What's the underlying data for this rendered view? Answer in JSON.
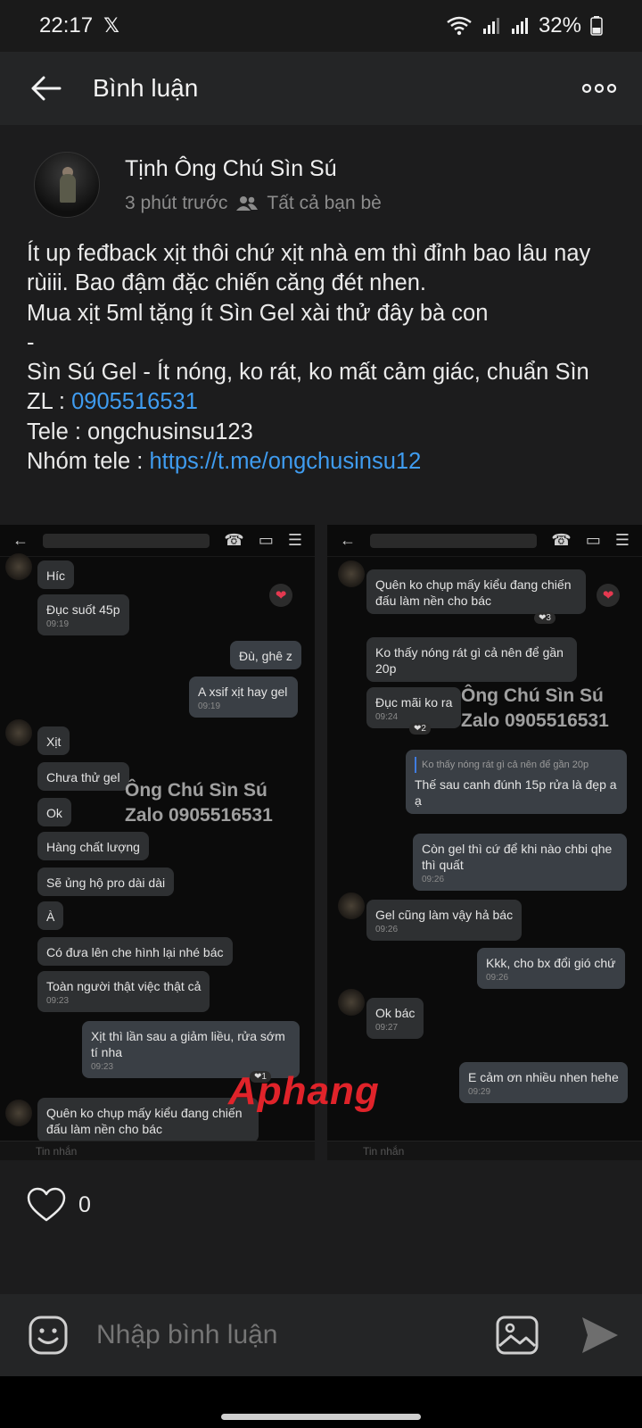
{
  "status_bar": {
    "time": "22:17",
    "battery": "32%"
  },
  "header": {
    "title": "Bình luận"
  },
  "post": {
    "author": "Tịnh Ông Chú Sìn Sú",
    "time": "3 phút trước",
    "audience": "Tất cả bạn bè",
    "lines": {
      "l1": "Ít up feđback xịt thôi chứ xịt nhà em thì đỉnh bao lâu nay rùiii. Bao đậm đặc chiến căng đét nhen.",
      "l2": "Mua xịt 5ml tặng ít Sìn Gel xài thử đây bà con",
      "l3": "-",
      "l4": "Sìn Sú Gel - Ít nóng, ko rát, ko mất cảm giác, chuẩn Sìn",
      "zl_label": "ZL : ",
      "zl_value": "0905516531",
      "tele_label": "Tele : ",
      "tele_value": "ongchusinsu123",
      "group_label": "Nhóm tele : ",
      "group_value": "https://t.me/ongchusinsu12"
    }
  },
  "attachment": {
    "left": {
      "msgs": {
        "m1": "Híc",
        "m2": "Đục suốt 45p",
        "m2t": "09:19",
        "m3": "Đù, ghê z",
        "m4": "A xsif xịt hay gel",
        "m4t": "09:19",
        "m5": "Xịt",
        "m6": "Chưa thử gel",
        "m7": "Ok",
        "m8": "Hàng chất lượng",
        "m9": "Sẽ ủng hộ pro dài dài",
        "m10": "À",
        "m11": "Có đưa lên che hình lại nhé bác",
        "m12": "Toàn người thật việc thật cả",
        "m12t": "09:23",
        "m13": "Xịt thì lần sau a giảm liều, rửa sớm tí nha",
        "m13t": "09:23",
        "m14": "Quên ko chụp mấy kiểu đang chiến đấu làm nền cho bác",
        "r1": "❤1"
      },
      "wm1": "Ông Chú Sìn Sú",
      "wm2": "Zalo 0905516531",
      "input_ph": "Tin nhắn"
    },
    "right": {
      "msgs": {
        "m1": "Quên ko chụp mấy kiểu đang chiến đấu làm nền cho bác",
        "m2": "Ko thấy nóng rát gì cả nên để gần 20p",
        "m3": "Đục mãi ko ra",
        "m3t": "09:24",
        "m4q": "Ko thấy nóng rát gì cả nên để gần 20p",
        "m4": "Thế sau canh đúnh 15p rửa là đẹp a ạ",
        "m5": "Còn gel thì cứ để khi nào chbi qhe thì quất",
        "m5t": "09:26",
        "m6": "Gel cũng làm vậy hả bác",
        "m6t": "09:26",
        "m7": "Kkk, cho bx đổi gió chứ",
        "m7t": "09:26",
        "m8": "Ok bác",
        "m8t": "09:27",
        "m9": "E cảm ơn nhiều nhen hehe",
        "m9t": "09:29",
        "r1": "❤3",
        "r2": "❤2"
      },
      "wm1": "Ông Chú Sìn Sú",
      "wm2": "Zalo 0905516531",
      "input_ph": "Tin nhắn"
    },
    "brand": "Aphang"
  },
  "likes": {
    "count": "0"
  },
  "comment_bar": {
    "placeholder": "Nhập bình luận"
  },
  "colors": {
    "link": "#3f9cf0",
    "background": "#1c1c1d",
    "header": "#242526"
  },
  "icons": [
    "wifi-icon",
    "signal-icon",
    "battery-icon",
    "back-arrow-icon",
    "more-icon",
    "friends-icon",
    "heart-icon",
    "sticker-icon",
    "image-icon",
    "send-icon"
  ]
}
